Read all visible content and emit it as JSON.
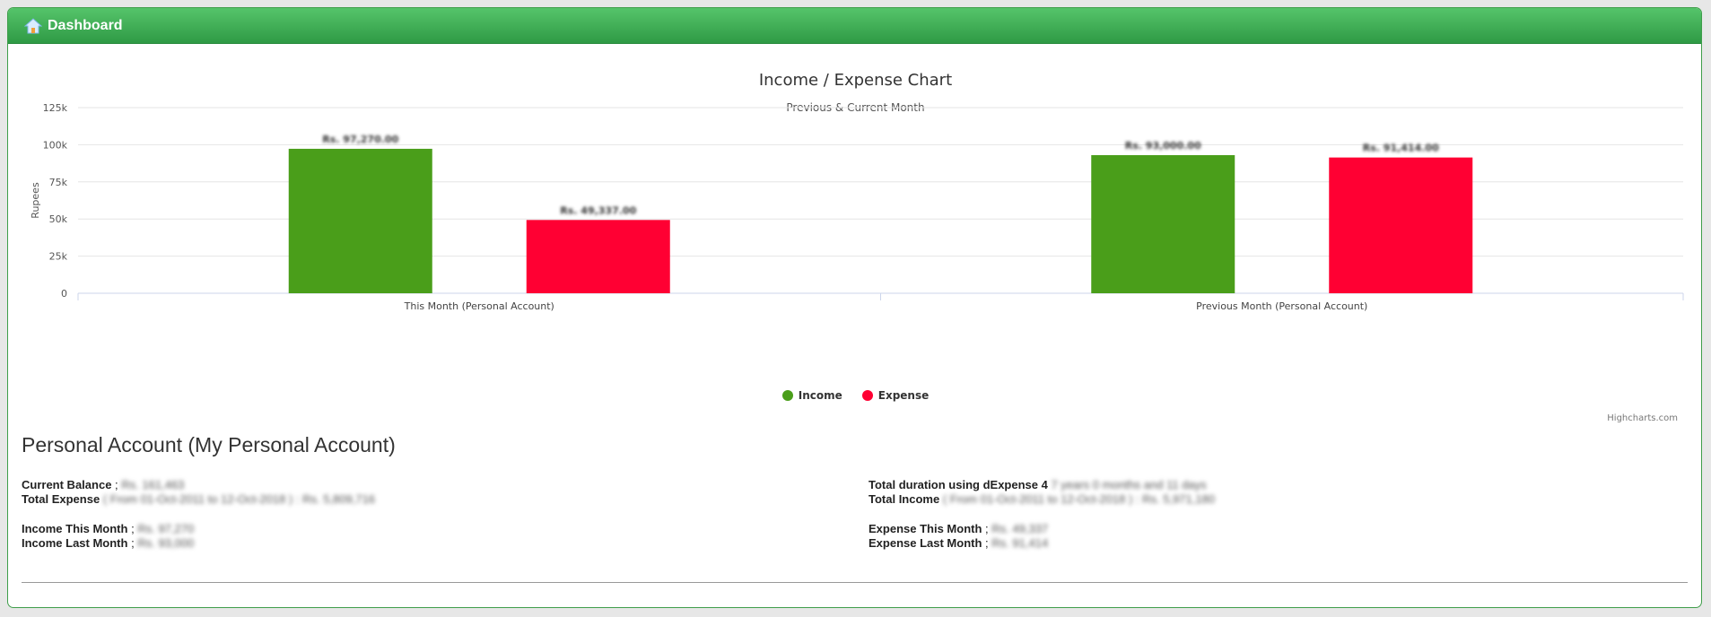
{
  "header": {
    "title": "Dashboard",
    "icon": "home-icon"
  },
  "chart": {
    "title": "Income / Expense Chart",
    "subtitle": "Previous & Current Month",
    "credits": "Highcharts.com"
  },
  "chart_data": {
    "type": "bar",
    "categories": [
      "This Month (Personal Account)",
      "Previous Month (Personal Account)"
    ],
    "series": [
      {
        "name": "Income",
        "color": "#4a9e1a",
        "values": [
          97270,
          93000
        ],
        "labels": [
          "Rs. 97,270.00",
          "Rs. 93,000.00"
        ]
      },
      {
        "name": "Expense",
        "color": "#ff0033",
        "values": [
          49337,
          91414
        ],
        "labels": [
          "Rs. 49,337.00",
          "Rs. 91,414.00"
        ]
      }
    ],
    "ylabel": "Rupees",
    "yticks": [
      "0",
      "25k",
      "50k",
      "75k",
      "100k",
      "125k"
    ],
    "ylim": [
      0,
      125000
    ],
    "grid": true,
    "legend": "bottom-center"
  },
  "account": {
    "title": "Personal Account (My Personal Account)",
    "current_balance_label": "Current Balance",
    "current_balance_value": "Rs. 161,463",
    "total_expense_label": "Total Expense",
    "total_expense_value": "( From 01-Oct-2011 to 12-Oct-2018 ) : Rs. 5,809,716",
    "income_this_month_label": "Income This Month",
    "income_this_month_value": "Rs. 97,270",
    "income_last_month_label": "Income Last Month",
    "income_last_month_value": "Rs. 93,000",
    "total_duration_label": "Total duration using dExpense 4",
    "total_duration_value": "7 years 0 months and 11 days",
    "total_income_label": "Total Income",
    "total_income_value": "( From 01-Oct-2011 to 12-Oct-2018 ) : Rs. 5,971,180",
    "expense_this_month_label": "Expense This Month",
    "expense_this_month_value": "Rs. 49,337",
    "expense_last_month_label": "Expense Last Month",
    "expense_last_month_value": "Rs. 91,414",
    "separator": ";"
  }
}
